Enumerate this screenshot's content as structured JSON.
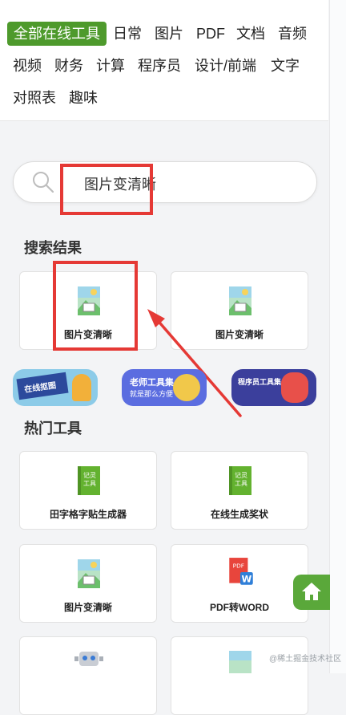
{
  "nav": {
    "items": [
      {
        "label": "全部在线工具",
        "active": true
      },
      {
        "label": "日常"
      },
      {
        "label": "图片"
      },
      {
        "label": "PDF"
      },
      {
        "label": "文档"
      },
      {
        "label": "音频"
      },
      {
        "label": "视频"
      },
      {
        "label": "财务"
      },
      {
        "label": "计算"
      },
      {
        "label": "程序员"
      },
      {
        "label": "设计/前端"
      },
      {
        "label": "文字"
      },
      {
        "label": "对照表"
      },
      {
        "label": "趣味"
      }
    ]
  },
  "search": {
    "value": "图片变清晰",
    "icon": "search-icon"
  },
  "results": {
    "title": "搜索结果",
    "cards": [
      {
        "label": "图片变清晰",
        "icon": "image-file-icon"
      },
      {
        "label": "图片变清晰",
        "icon": "image-file-icon"
      }
    ]
  },
  "banners": [
    {
      "text": "在线抠图"
    },
    {
      "text": "老师工具集",
      "sub": "就是那么方便"
    },
    {
      "text": "程序员工具集"
    }
  ],
  "hot": {
    "title": "热门工具",
    "cards": [
      {
        "label": "田字格字贴生成器",
        "icon": "notebook-icon",
        "badge": "记灵工具"
      },
      {
        "label": "在线生成奖状",
        "icon": "notebook-icon",
        "badge": "记灵工具"
      },
      {
        "label": "图片变清晰",
        "icon": "image-file-icon"
      },
      {
        "label": "PDF转WORD",
        "icon": "pdf-word-icon"
      }
    ]
  },
  "watermark": "@稀土掘金技术社区",
  "colors": {
    "accent": "#4e9a2c",
    "highlight": "#e53935"
  }
}
